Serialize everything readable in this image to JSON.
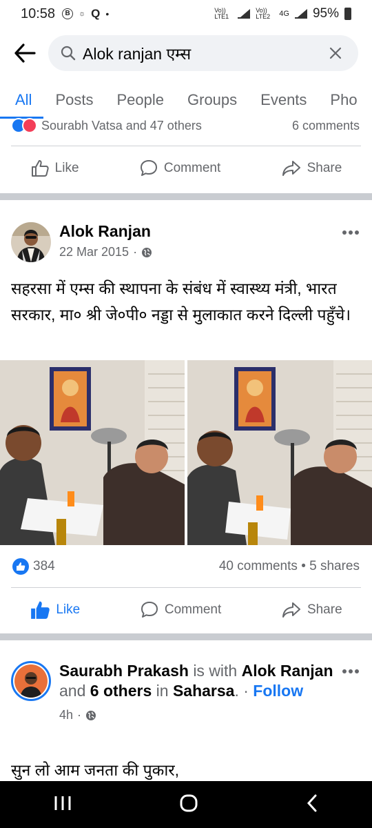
{
  "status_bar": {
    "time": "10:58",
    "network_1": "Vo)) LTE1",
    "network_2": "Vo)) LTE2",
    "network_type": "4G",
    "battery": "95%"
  },
  "search": {
    "query": "Alok ranjan एम्स"
  },
  "tabs": [
    {
      "label": "All",
      "active": true
    },
    {
      "label": "Posts"
    },
    {
      "label": "People"
    },
    {
      "label": "Groups"
    },
    {
      "label": "Events"
    },
    {
      "label": "Pho"
    }
  ],
  "prev_post": {
    "reaction_text": "Sourabh Vatsa and 47 others",
    "comments": "6 comments",
    "actions": {
      "like": "Like",
      "comment": "Comment",
      "share": "Share"
    }
  },
  "post": {
    "author": "Alok Ranjan",
    "date": "22 Mar 2015",
    "separator": "·",
    "text": "सहरसा में एम्स की स्थापना के संबंध में स्वास्थ्य मंत्री, भारत सरकार, मा० श्री जे०पी० नड्डा से मुलाकात करने दिल्ली पहुँचे।",
    "likes": "384",
    "comments": "40 comments",
    "shares": "5 shares",
    "actions": {
      "like": "Like",
      "comment": "Comment",
      "share": "Share"
    },
    "accent": "#1877f2"
  },
  "next_post": {
    "author": "Saurabh Prakash",
    "is_with": "is with",
    "tagged": "Alok Ranjan",
    "and": "and",
    "others": "6 others",
    "in": "in",
    "place": "Saharsa",
    "dot": ".",
    "sep": "·",
    "follow": "Follow",
    "time": "4h",
    "text": "सुन लो आम जनता की पुकार,"
  }
}
